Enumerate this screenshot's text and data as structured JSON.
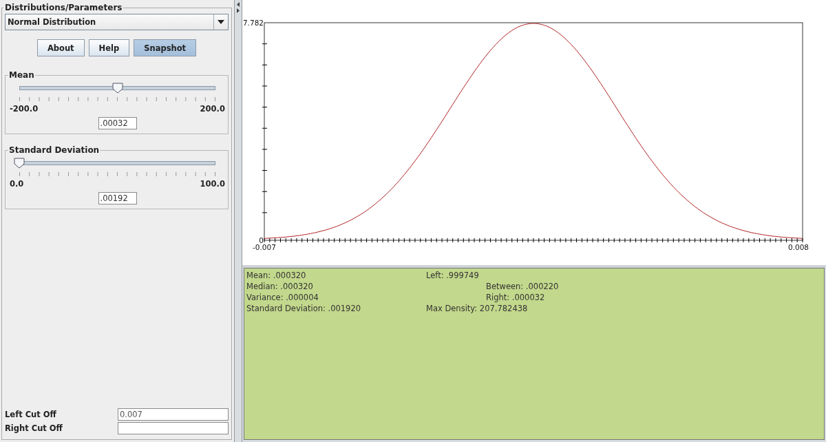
{
  "left_panel": {
    "title": "Distributions/Parameters",
    "distribution_select": {
      "value": "Normal Distribution"
    },
    "buttons": [
      {
        "label": "About",
        "selected": false
      },
      {
        "label": "Help",
        "selected": false
      },
      {
        "label": "Snapshot",
        "selected": true
      }
    ],
    "parameters": [
      {
        "name": "Mean",
        "level": 0.5,
        "min_label": "-200.0",
        "max_label": "200.0",
        "value": ".00032"
      },
      {
        "name": "Standard Deviation",
        "level": 0.0,
        "min_label": "0.0",
        "max_label": "100.0",
        "value": ".00192"
      }
    ],
    "cut_offs": [
      {
        "label": "Left Cut Off",
        "value": "0.007"
      },
      {
        "label": "Right Cut Off"
      }
    ]
  },
  "plot": {
    "y_max_label": "7.782",
    "y_min_label": "0",
    "x_min_label": "-0.007",
    "x_max_label": "0.008"
  },
  "stats": {
    "column_1": [
      "Mean: .000320",
      "Median: .000320",
      "Variance: .000004",
      "Standard Deviation: .001920"
    ],
    "column_2": [
      {
        "text": "Left: .999749",
        "kind": "plain"
      },
      {
        "text": "Between: .000220",
        "kind": "indented"
      },
      {
        "text": "Right: .000032",
        "kind": "indented"
      },
      {
        "text": "Max Density: 207.782438",
        "kind": "plain"
      }
    ]
  }
}
